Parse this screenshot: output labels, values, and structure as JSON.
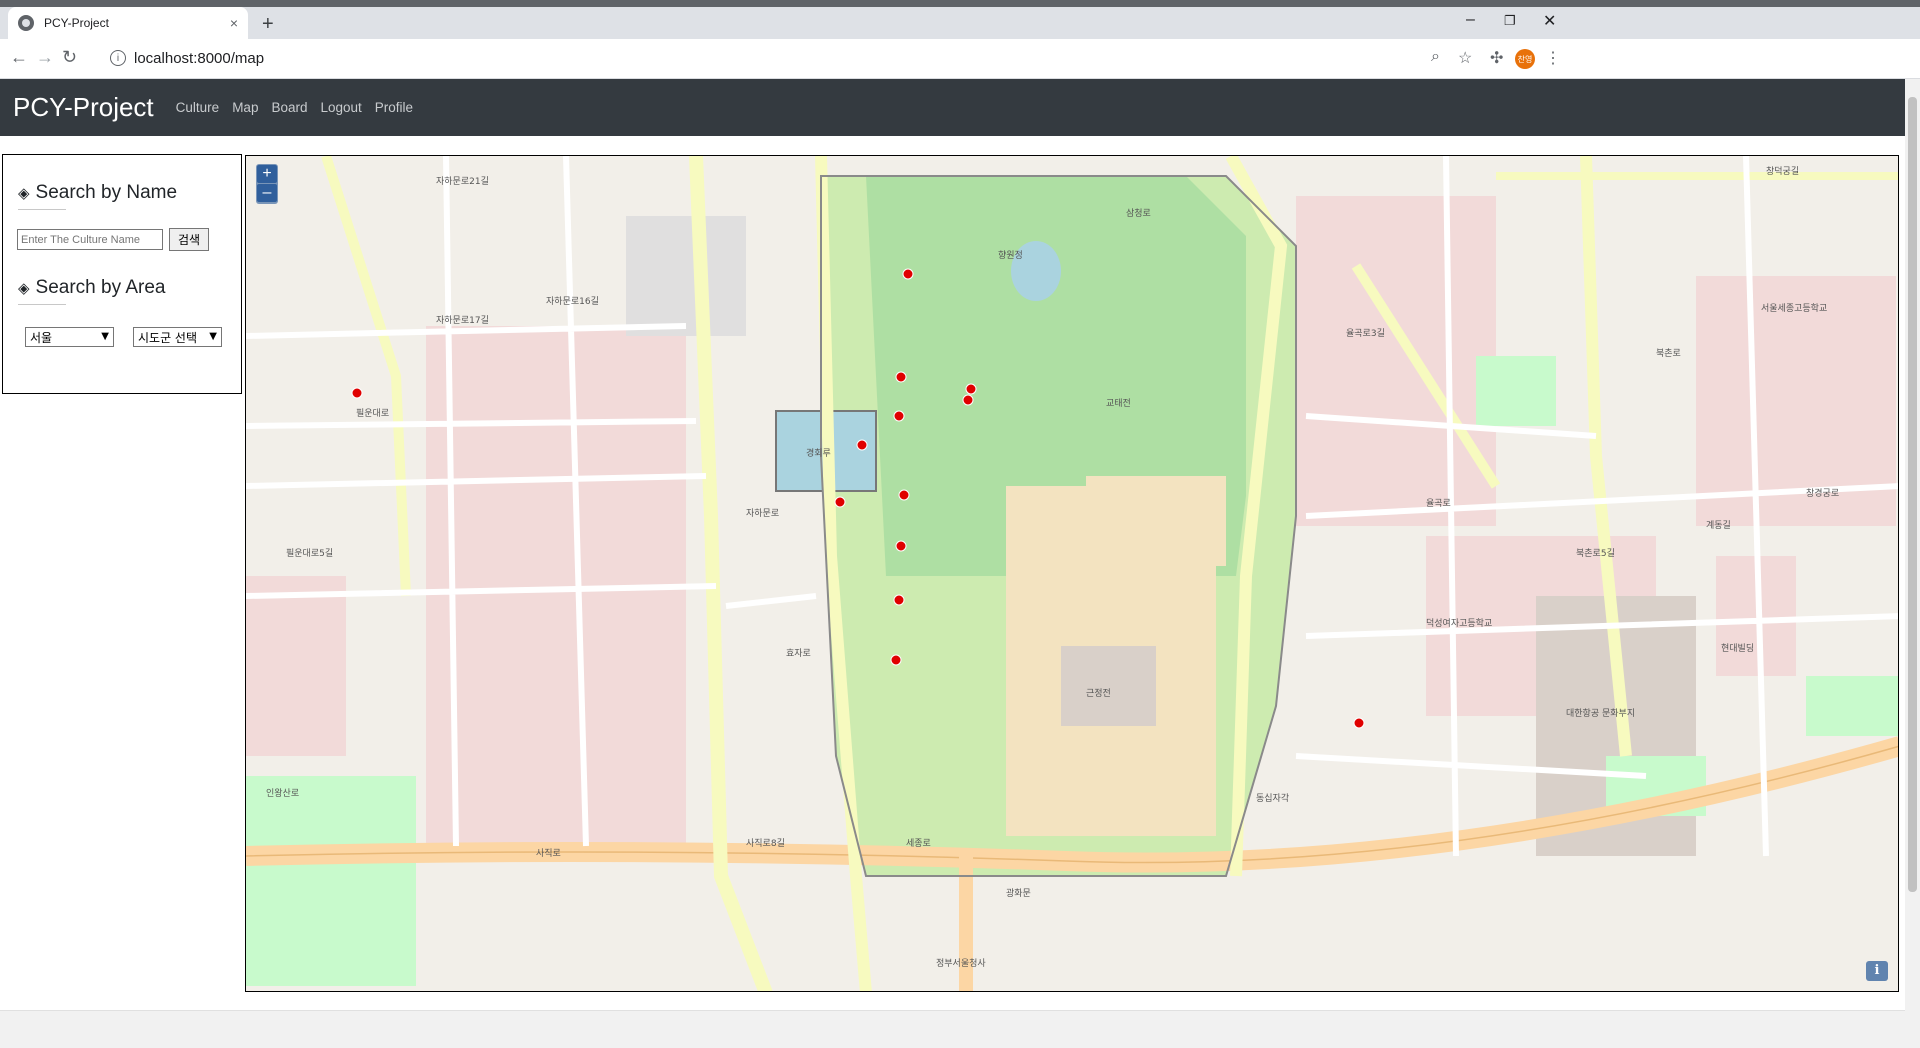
{
  "browser": {
    "tab_title": "PCY-Project",
    "tab_close": "×",
    "new_tab": "+",
    "url": "localhost:8000/map",
    "profile_initials": "찬영",
    "window_controls": [
      "–",
      "❐",
      "✕"
    ]
  },
  "navbar": {
    "brand": "PCY-Project",
    "links": [
      "Culture",
      "Map",
      "Board",
      "Logout",
      "Profile"
    ]
  },
  "search": {
    "by_name_title": "Search by Name",
    "name_placeholder": "Enter The Culture Name",
    "search_button": "검색",
    "by_area_title": "Search by Area",
    "province_selected": "서울",
    "district_selected": "시도군 선택"
  },
  "map": {
    "zoom_in": "+",
    "zoom_out": "–",
    "info": "i",
    "marker_color": "#e00000",
    "marker_count": 13,
    "labels": {
      "l1": "자하문로21길",
      "l2": "자하문로17길",
      "l3": "자하문로16길",
      "l4": "필운대로",
      "l5": "사직로",
      "l6": "율곡로",
      "l7": "삼청로",
      "l8": "북촌로",
      "l9": "창덕궁길",
      "l10": "창경궁로",
      "l11": "효자로",
      "l12": "인왕산로",
      "l13": "근정전",
      "l14": "경회루",
      "l15": "광화문",
      "l16": "대한항공 문화부지",
      "l17": "덕성여자고등학교",
      "l18": "현대빌딩",
      "l19": "서울세종고등학교",
      "l20": "향원정",
      "l21": "교태전",
      "l22": "자하문로",
      "l23": "율곡로3길",
      "l24": "계동길",
      "l25": "북촌로5길",
      "l26": "필운대로5길",
      "l27": "동십자각",
      "l28": "정부서울청사",
      "l29": "세종로",
      "l30": "사직로8길"
    }
  }
}
